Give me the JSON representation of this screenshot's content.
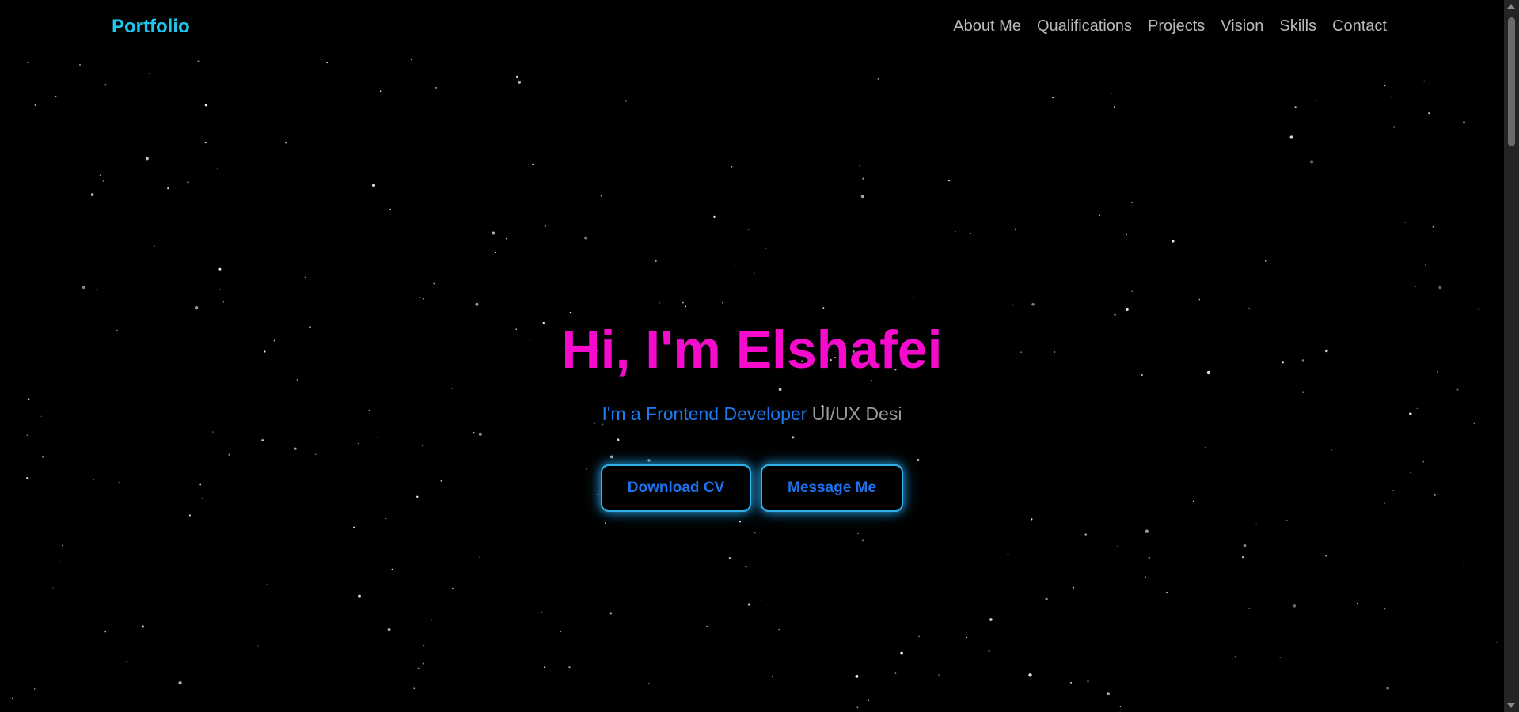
{
  "nav": {
    "logo": "Portfolio",
    "links": [
      "About Me",
      "Qualifications",
      "Projects",
      "Vision",
      "Skills",
      "Contact"
    ]
  },
  "hero": {
    "title": "Hi, I'm Elshafei",
    "subtitle_typed": "I'm a Frontend Developer",
    "subtitle_partial": "UI/UX Desi",
    "buttons": {
      "download": "Download CV",
      "message": "Message Me"
    }
  },
  "colors": {
    "background": "#000000",
    "logo": "#1ec7ef",
    "title": "#f40bcb",
    "accent_blue": "#1d7bf2",
    "nav_border": "#1fc9b4",
    "button_glow": "#2fb4ec"
  }
}
